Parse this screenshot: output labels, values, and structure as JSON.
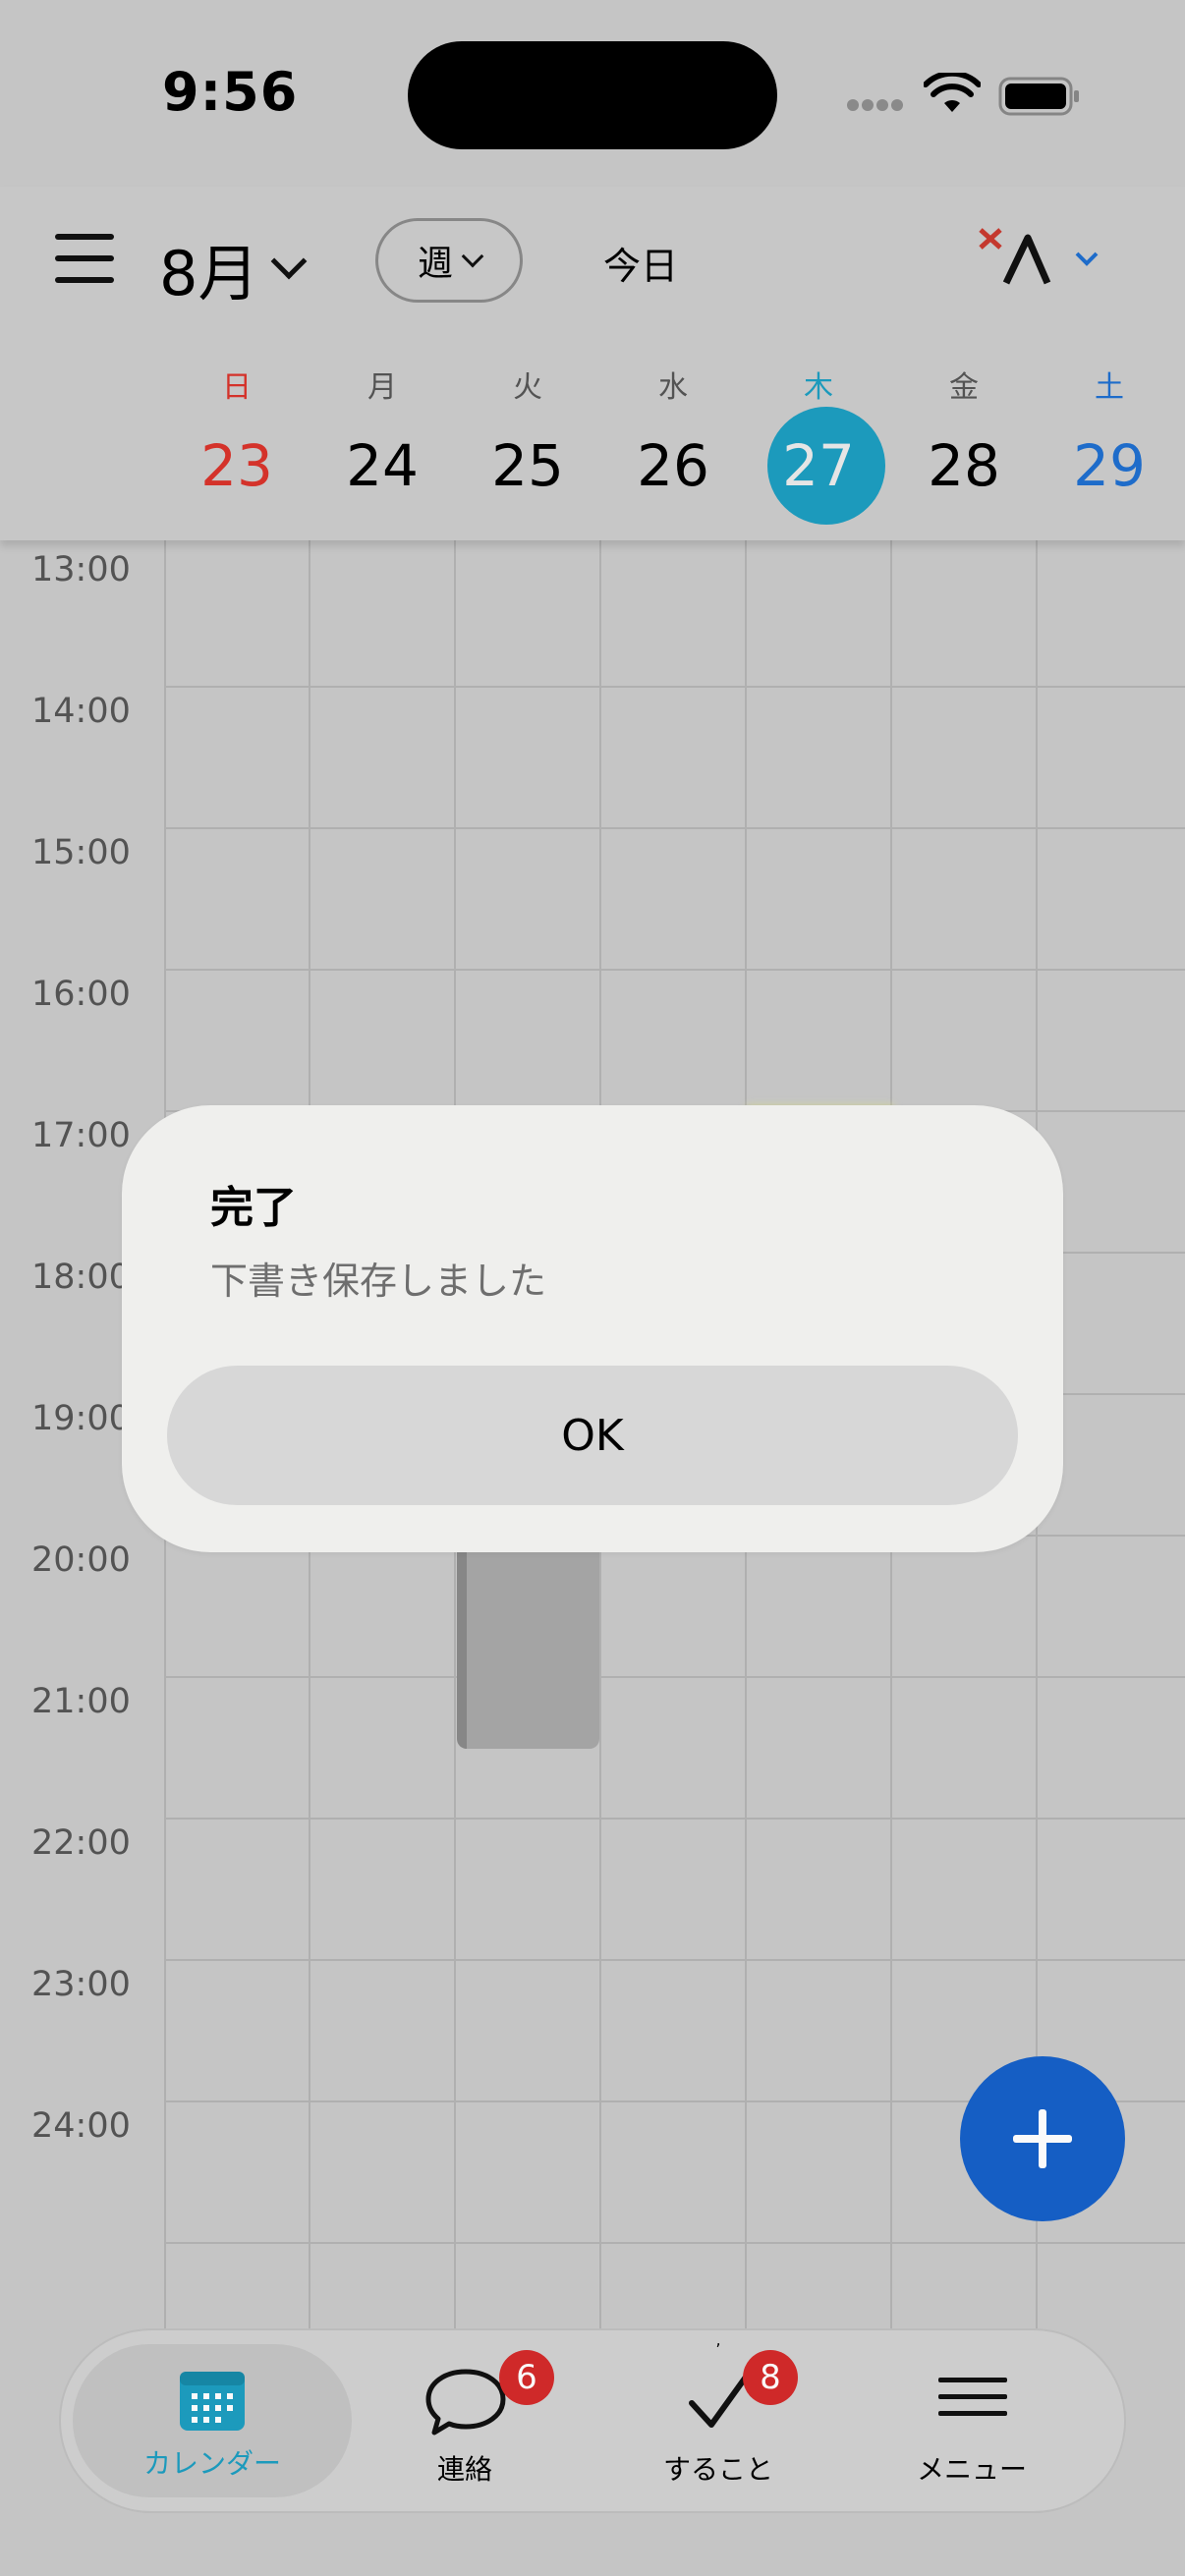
{
  "status_bar": {
    "time": "9:56"
  },
  "header": {
    "month_label": "8月",
    "view_mode_label": "週",
    "today_label": "今日"
  },
  "week": [
    {
      "dow": "日",
      "num": "23",
      "color": "#d9342b"
    },
    {
      "dow": "月",
      "num": "24",
      "color": "#111111"
    },
    {
      "dow": "火",
      "num": "25",
      "color": "#111111"
    },
    {
      "dow": "水",
      "num": "26",
      "color": "#111111"
    },
    {
      "dow": "木",
      "num": "27",
      "color": "#1d9ec0",
      "today": true
    },
    {
      "dow": "金",
      "num": "28",
      "color": "#111111"
    },
    {
      "dow": "土",
      "num": "29",
      "color": "#1f6fcf"
    }
  ],
  "hours": [
    "13:00",
    "14:00",
    "15:00",
    "16:00",
    "17:00",
    "18:00",
    "19:00",
    "20:00",
    "21:00",
    "22:00",
    "23:00",
    "24:00"
  ],
  "dialog": {
    "title": "完了",
    "message": "下書き保存しました",
    "ok_label": "OK"
  },
  "tabs": [
    {
      "label": "カレンダー",
      "icon": "calendar-icon",
      "active": true
    },
    {
      "label": "連絡",
      "icon": "chat-bubble-icon",
      "badge": "6"
    },
    {
      "label": "すること",
      "icon": "checkmark-icon",
      "badge": "8"
    },
    {
      "label": "メニュー",
      "icon": "menu-icon"
    }
  ],
  "colors": {
    "accent": "#1d9ec0",
    "fab": "#1660c8",
    "badge": "#d42a2a"
  }
}
